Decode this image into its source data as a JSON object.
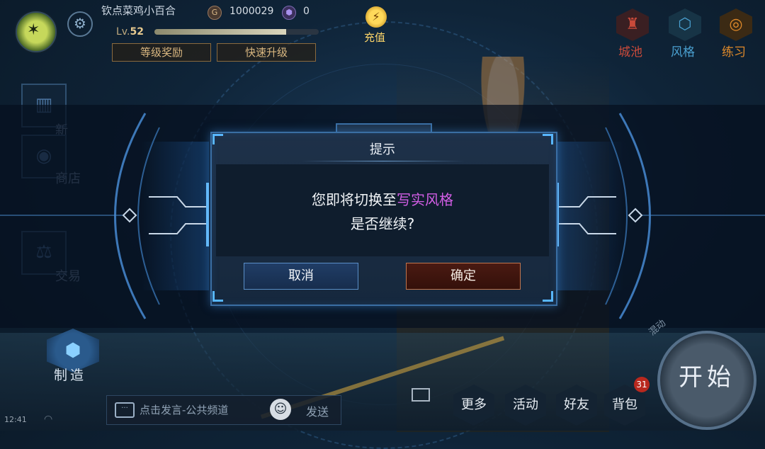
{
  "player": {
    "name": "钦点菜鸡小百合",
    "coins": "1000029",
    "gems": "0",
    "level_prefix": "Lv.",
    "level": "52",
    "exp_fraction": 0.8
  },
  "top_buttons": {
    "level_reward": "等级奖励",
    "quick_upgrade": "快速升级",
    "recharge": "充值"
  },
  "top_right": [
    {
      "label": "城池",
      "icon": "castle-icon",
      "color": "#c94a3a"
    },
    {
      "label": "风格",
      "icon": "hexagons-icon",
      "color": "#4aa0d0"
    },
    {
      "label": "练习",
      "icon": "target-icon",
      "color": "#e08a2a"
    }
  ],
  "side_menu": [
    {
      "label": "新",
      "icon": "book-icon"
    },
    {
      "label": "商店",
      "icon": "shop-icon"
    },
    {
      "label": "交易",
      "icon": "trade-icon"
    }
  ],
  "craft": {
    "label": "制造"
  },
  "dialog": {
    "title": "提示",
    "message_prefix": "您即将切换至",
    "message_highlight": "写实风格",
    "message_line2": "是否继续?",
    "cancel": "取消",
    "confirm": "确定"
  },
  "chat": {
    "placeholder": "点击发言-公共频道",
    "send": "发送"
  },
  "status": {
    "time": "12:41"
  },
  "bottom_menu": {
    "more": "更多",
    "activity": "活动",
    "friends": "好友",
    "bag": "背包",
    "bag_badge": "31"
  },
  "start": {
    "label": "开始",
    "arc_text": "混动"
  },
  "colors": {
    "highlight": "#d35ee6",
    "accent_blue": "#3a6ea3",
    "gold": "#d9b780"
  }
}
